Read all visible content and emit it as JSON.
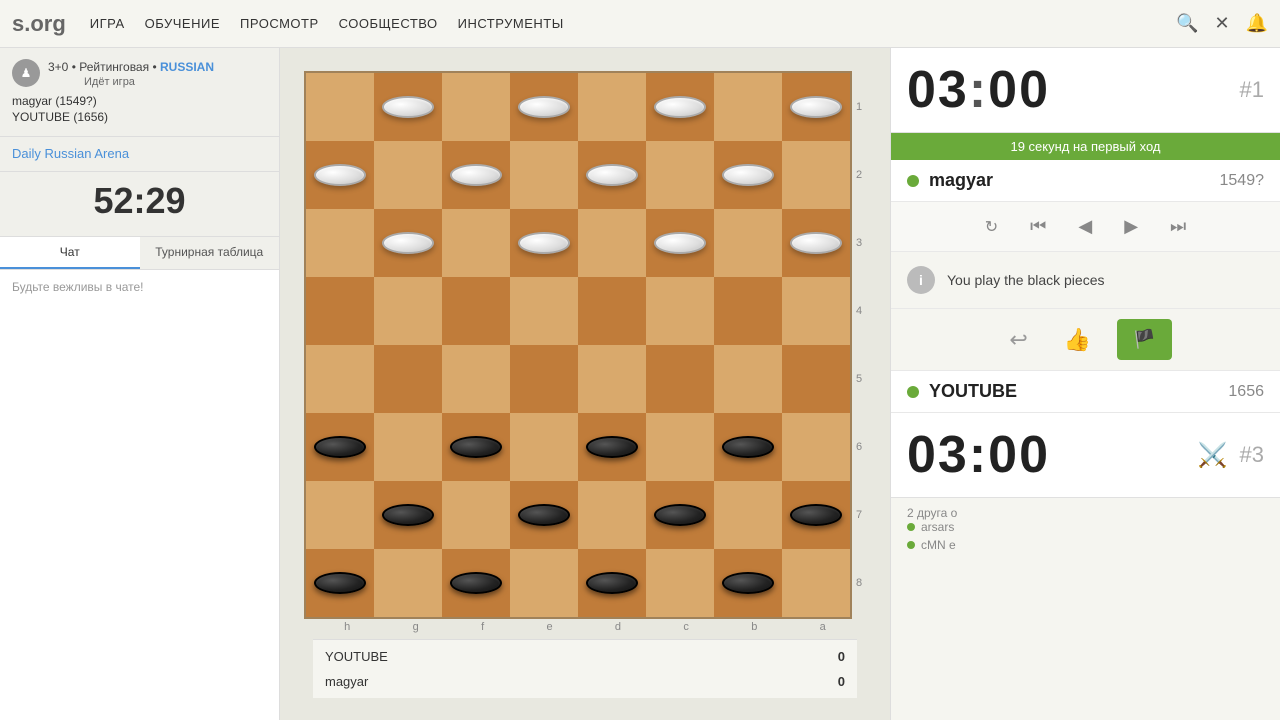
{
  "nav": {
    "logo": "s.org",
    "items": [
      "ИГРА",
      "ОБУЧЕНИЕ",
      "ПРОСМОТР",
      "СООБЩЕСТВО",
      "ИНСТРУМЕНТЫ"
    ]
  },
  "sidebar": {
    "game_type": "3+0 • Рейтинговая •",
    "game_type_variant": "RUSSIAN",
    "game_status": "Идёт игра",
    "player1_name": "magyar",
    "player1_rating": "(1549?)",
    "player2_name": "YOUTUBE",
    "player2_rating": "(1656)",
    "tournament_link": "Daily Russian Arena",
    "timer": "52:29",
    "tabs": [
      "Чат",
      "Турнирная таблица"
    ],
    "chat_hint": "Будьте вежливы в чате!"
  },
  "board": {
    "file_labels": [
      "h",
      "g",
      "f",
      "e",
      "d",
      "c",
      "b",
      "a"
    ],
    "rank_labels": [
      "1",
      "2",
      "3",
      "4",
      "5",
      "6",
      "7",
      "8"
    ]
  },
  "right_panel": {
    "timer_top": "03:00",
    "timer_top_colon": ":",
    "game_number_top": "#1",
    "first_move_banner": "19 секунд на первый ход",
    "player1": {
      "name": "magyar",
      "rating": "1549?"
    },
    "controls": {
      "refresh": "↻",
      "first": "⏮",
      "prev": "◀",
      "next": "▶",
      "last": "⏭"
    },
    "info_text": "You play the black pieces",
    "timer_bottom": "03:00",
    "timer_bottom_colon": ":",
    "game_number_bottom": "#3",
    "player2": {
      "name": "YOUTUBE",
      "rating": "1656"
    },
    "spectators_label": "2 друга о",
    "spectators": [
      "arsars",
      "cMN e"
    ]
  },
  "scores": [
    {
      "name": "YOUTUBE",
      "score": "0"
    },
    {
      "name": "magyar",
      "score": "0"
    }
  ],
  "colors": {
    "green": "#6aaa3a",
    "blue": "#4a90d9",
    "board_light": "#d9a96c",
    "board_dark": "#c07c3a"
  }
}
